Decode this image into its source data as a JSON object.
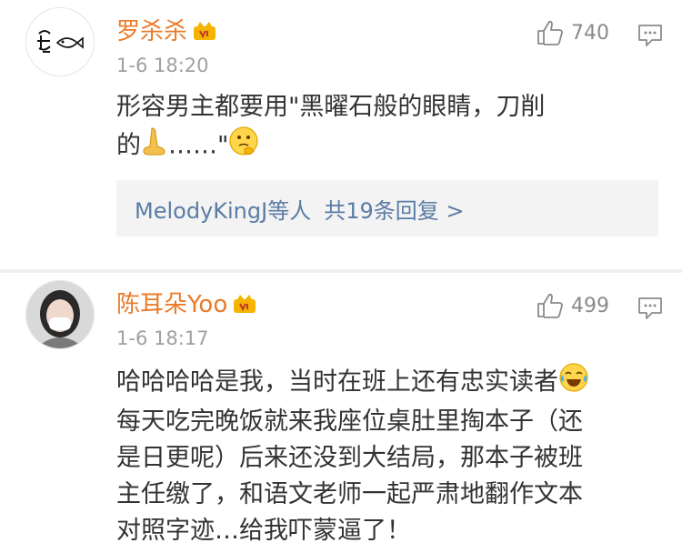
{
  "comments": [
    {
      "username": "罗杀杀",
      "timestamp": "1-6 18:20",
      "like_count": "740",
      "text_lines": [
        "形容男主都要用\"黑曜石般的眼睛，刀削",
        "的",
        "……\""
      ],
      "replies": {
        "who": "MelodyKingJ等人",
        "count_text": "共19条回复 >"
      },
      "emojis": [
        "nose-emoji",
        "thinking-emoji"
      ]
    },
    {
      "username": "陈耳朵Yoo",
      "timestamp": "1-6 18:17",
      "like_count": "499",
      "text_lines": [
        "哈哈哈哈是我，当时在班上还有忠实读者",
        "每天吃完晚饭就来我座位桌肚里掏本子（还",
        "是日更呢）后来还没到大结局，那本子被班",
        "主任缴了，和语文老师一起严肃地翻作文本",
        "对照字迹…给我吓蒙逼了！"
      ],
      "emojis": [
        "laughing-tears-emoji"
      ]
    }
  ],
  "colors": {
    "username": "#ea7b2a",
    "link": "#5b7ca6",
    "meta": "#a0a0a0",
    "reply_bg": "#f3f3f3"
  }
}
